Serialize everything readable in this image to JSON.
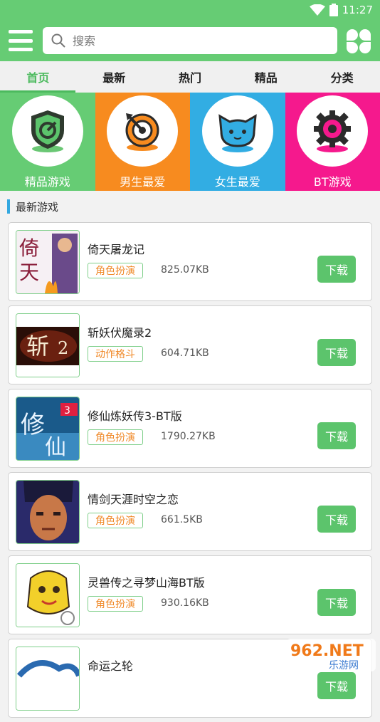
{
  "status": {
    "time": "11:27"
  },
  "search": {
    "placeholder": "搜索"
  },
  "tabs": [
    {
      "label": "首页"
    },
    {
      "label": "最新"
    },
    {
      "label": "热门"
    },
    {
      "label": "精品"
    },
    {
      "label": "分类"
    }
  ],
  "categories": [
    {
      "label": "精品游戏",
      "color": "#66cc74"
    },
    {
      "label": "男生最爱",
      "color": "#f78b1f"
    },
    {
      "label": "女生最爱",
      "color": "#32ade3"
    },
    {
      "label": "BT游戏",
      "color": "#f5198d"
    }
  ],
  "section": {
    "title": "最新游戏"
  },
  "games": [
    {
      "name": "倚天屠龙记",
      "tag": "角色扮演",
      "size": "825.07KB",
      "download": "下载"
    },
    {
      "name": "斩妖伏魔录2",
      "tag": "动作格斗",
      "size": "604.71KB",
      "download": "下载"
    },
    {
      "name": "修仙炼妖传3-BT版",
      "tag": "角色扮演",
      "size": "1790.27KB",
      "download": "下载"
    },
    {
      "name": "情剑天涯时空之恋",
      "tag": "角色扮演",
      "size": "661.5KB",
      "download": "下载"
    },
    {
      "name": "灵兽传之寻梦山海BT版",
      "tag": "角色扮演",
      "size": "930.16KB",
      "download": "下载"
    },
    {
      "name": "命运之轮",
      "tag": "",
      "size": "",
      "download": "下载"
    }
  ],
  "watermark": {
    "line1": "962.NET",
    "line2": "乐游网"
  }
}
